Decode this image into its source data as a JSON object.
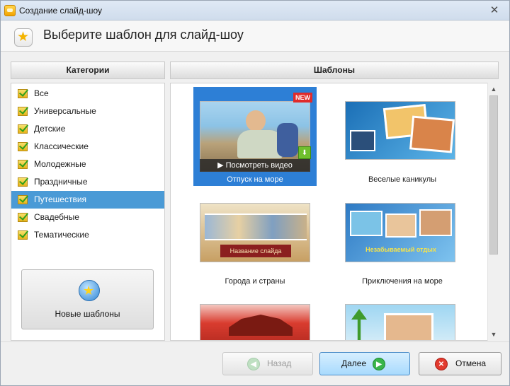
{
  "window": {
    "title": "Создание слайд-шоу",
    "close_glyph": "✕"
  },
  "header": {
    "title": "Выберите шаблон для слайд-шоу",
    "icon": "star-icon"
  },
  "categories": {
    "heading": "Категории",
    "items": [
      {
        "label": "Все"
      },
      {
        "label": "Универсальные"
      },
      {
        "label": "Детские"
      },
      {
        "label": "Классические"
      },
      {
        "label": "Молодежные"
      },
      {
        "label": "Праздничные"
      },
      {
        "label": "Путешествия"
      },
      {
        "label": "Свадебные"
      },
      {
        "label": "Тематические"
      }
    ],
    "selected_index": 6,
    "new_templates_label": "Новые шаблоны"
  },
  "templates": {
    "heading": "Шаблоны",
    "items": [
      {
        "label": "Отпуск на море",
        "badge": "NEW",
        "preview_label": "▶ Посмотреть видео",
        "selected": true
      },
      {
        "label": "Веселые каникулы"
      },
      {
        "label": "Города и страны",
        "caption": "Название слайда"
      },
      {
        "label": "Приключения на море",
        "caption": "Незабываемый отдых"
      },
      {
        "label": ""
      },
      {
        "label": ""
      }
    ]
  },
  "footer": {
    "back_label": "Назад",
    "next_label": "Далее",
    "cancel_label": "Отмена"
  },
  "colors": {
    "selection": "#4a9ad6",
    "template_selection": "#2d7fd6",
    "new_badge": "#e02b2b"
  }
}
